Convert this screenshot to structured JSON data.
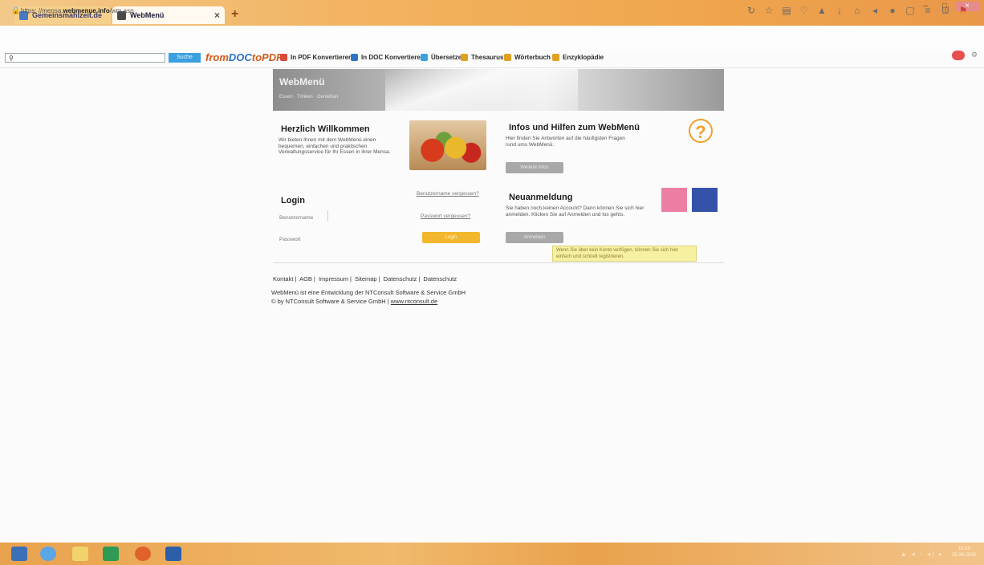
{
  "browser": {
    "tabs": [
      {
        "label": "Gemeinsmahlzeit.de"
      },
      {
        "label": "WebMenü"
      }
    ],
    "new_tab": "+",
    "url_prefix": "https:",
    "url_domain": "webmenue.info",
    "url_rest": "/wm.asp",
    "search_placeholder": "",
    "search_button": "Suche",
    "bookmark_logo_a": "from",
    "bookmark_logo_b": "DOC",
    "bookmark_logo_c": "toPDF",
    "bookmarks": [
      {
        "label": "In PDF Konvertieren",
        "color": "#d84a3a"
      },
      {
        "label": "In DOC Konvertieren",
        "color": "#2c74c8"
      },
      {
        "label": "Übersetzen",
        "color": "#3aa0e0"
      },
      {
        "label": "Thesaurus",
        "color": "#e0a020"
      },
      {
        "label": "Wörterbuch",
        "color": "#e0a020"
      },
      {
        "label": "Enzyklopädie",
        "color": "#e0a020"
      }
    ]
  },
  "page": {
    "logo": "WebMenü",
    "logo_sub": "Essen · Trinken · Genießen",
    "welcome": {
      "title": "Herzlich Willkommen",
      "text": "Wir bieten Ihnen mit dem WebMenü einen bequemen, einfachen und praktischen Verwaltungsservice für Ihr Essen in ihrer Mensa."
    },
    "info": {
      "title": "Infos und Hilfen zum WebMenü",
      "text": "Hier finden Sie Antworten auf die häufigsten Fragen rund ums WebMenü.",
      "button": "Weitere Infos"
    },
    "login": {
      "title": "Login",
      "forgot_user": "Benutzername vergessen?",
      "username_label": "Benutzername",
      "forgot_password": "Passwort vergessen?",
      "password_label": "Passwort",
      "button": "Login"
    },
    "register": {
      "title": "Neuanmeldung",
      "text": "Sie haben noch keinen Account? Dann können Sie sich hier anmelden. Klicken Sie auf Anmelden und los gehts.",
      "button": "Anmelden",
      "tooltip": "Wenn Sie über kein Konto verfügen, können Sie sich hier einfach und schnell registrieren."
    },
    "footer": {
      "links": [
        "Kontakt",
        "AGB",
        "Impressum",
        "Sitemap",
        "Datenschutz",
        "Datenschutz"
      ],
      "line1": "WebMenü ist eine Entwicklung der NTConsult Software & Service GmbH",
      "line2_prefix": "© by NTConsult Software & Service GmbH |",
      "line2_link": "www.ntconsult.de"
    }
  },
  "taskbar": {
    "tray": "▲ ◂ ▫ ◂) ▸",
    "time": "10:14",
    "date": "25.06.2015"
  }
}
